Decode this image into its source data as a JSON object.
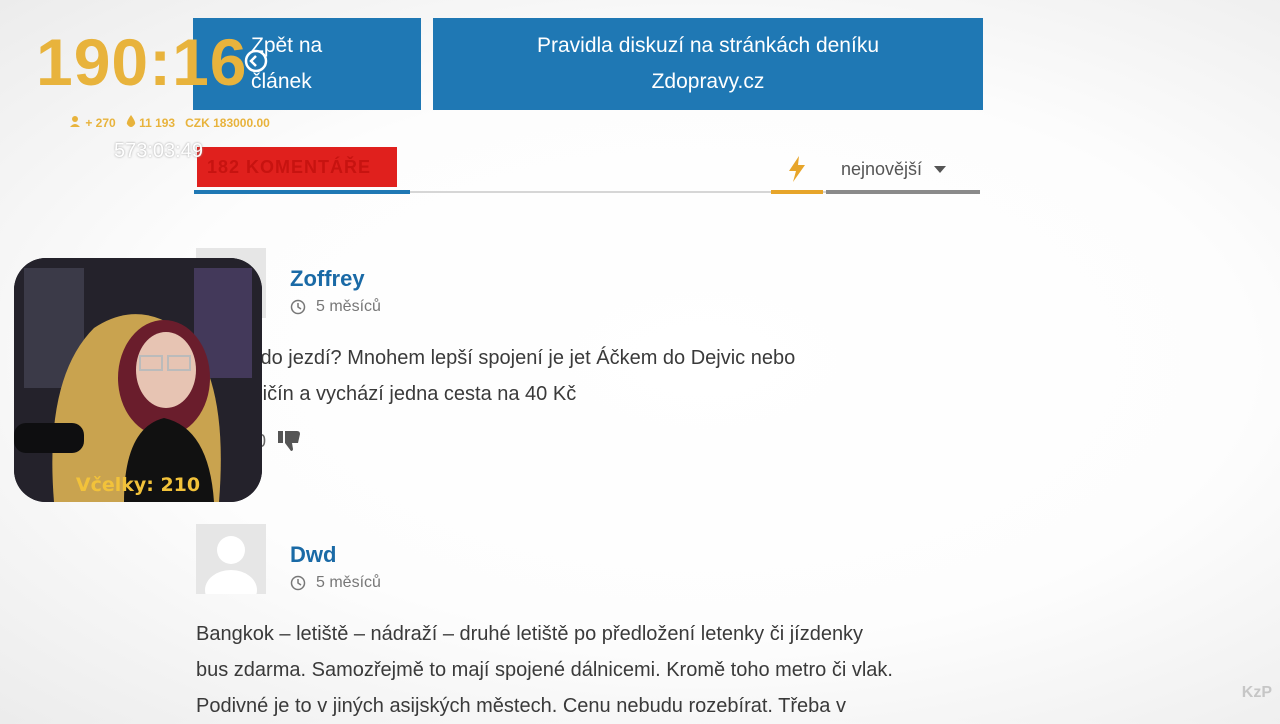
{
  "nav": {
    "back_label": "Zpět na článek",
    "rules_label": "Pravidla diskuzí na stránkách deníku Zdopravy.cz"
  },
  "tabs": {
    "count_label": "182 KOMENTÁŘE",
    "sort_label": "nejnovější"
  },
  "comments": [
    {
      "author": "Zoffrey",
      "time": "5 měsíců",
      "text_lines": [
        "stě někdo jezdí? Mnohem lepší spojení je jet Áčkem do Dejvic nebo",
        "m na Zličín a vychází jedna cesta na 40 Kč"
      ],
      "votes": "0"
    },
    {
      "author": "Dwd",
      "time": "5 měsíců",
      "text_lines": [
        "Bangkok – letiště – nádraží – druhé letiště po předložení letenky či jízdenky",
        "bus zdarma. Samozřejmě to mají spojené dálnicemi. Kromě toho metro či vlak.",
        "Podivné je to v jiných asijských městech. Cenu nebudu rozebírat. Třeba v"
      ]
    }
  ],
  "overlay": {
    "timer": "190:16",
    "followers": "+ 270",
    "bits": "11 193",
    "currency": "CZK 183000.00",
    "uptime": "573:03:49",
    "webcam_label": "Včelky:  210",
    "watermark": "KzP"
  },
  "colors": {
    "accent": "#1f78b4",
    "red": "#e0201d",
    "timer": "#e8b33c"
  }
}
